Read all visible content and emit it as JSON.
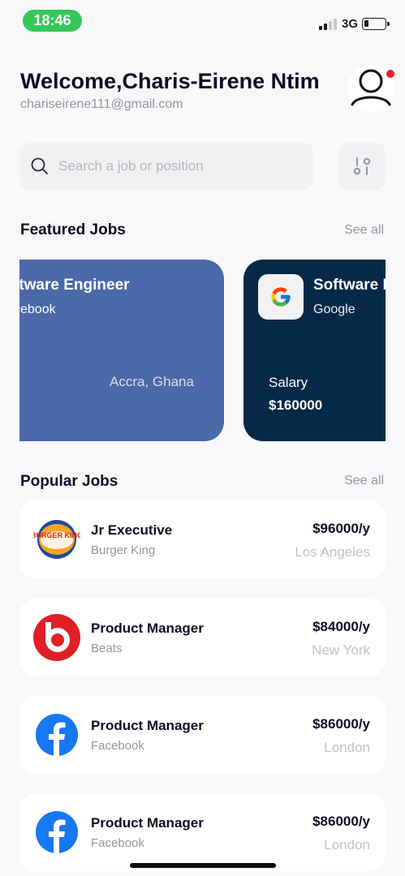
{
  "status_bar": {
    "time": "18:46",
    "network": "3G",
    "accent_color": "#34c759"
  },
  "header": {
    "welcome": "Welcome,Charis-Eirene Ntim",
    "email": "chariseirene111@gmail.com",
    "avatar_icon": "user-icon",
    "notification_color": "#e8202a"
  },
  "search": {
    "placeholder": "Search a job or position",
    "value": "",
    "icon": "search-icon",
    "filter_icon": "filter-icon"
  },
  "featured": {
    "title": "Featured Jobs",
    "see_all": "See all",
    "cards": [
      {
        "title": "ftware Engineer",
        "company": "cebook",
        "location": "Accra, Ghana",
        "bg_color": "#4b69a8"
      },
      {
        "title": "Software E",
        "company": "Google",
        "salary_label": "Salary",
        "salary": "$160000",
        "logo_icon": "google-logo-icon",
        "bg_color": "#062948"
      }
    ]
  },
  "popular": {
    "title": "Popular Jobs",
    "see_all": "See all",
    "jobs": [
      {
        "title": "Jr Executive",
        "company": "Burger King",
        "salary": "$96000/y",
        "location": "Los Angeles",
        "logo_icon": "burger-king-logo-icon",
        "logo_text": "BURGER KING"
      },
      {
        "title": "Product Manager",
        "company": "Beats",
        "salary": "$84000/y",
        "location": "New York",
        "logo_icon": "beats-logo-icon"
      },
      {
        "title": "Product Manager",
        "company": "Facebook",
        "salary": "$86000/y",
        "location": "London",
        "logo_icon": "facebook-logo-icon"
      },
      {
        "title": "Product Manager",
        "company": "Facebook",
        "salary": "$86000/y",
        "location": "London",
        "logo_icon": "facebook-logo-icon"
      }
    ]
  }
}
